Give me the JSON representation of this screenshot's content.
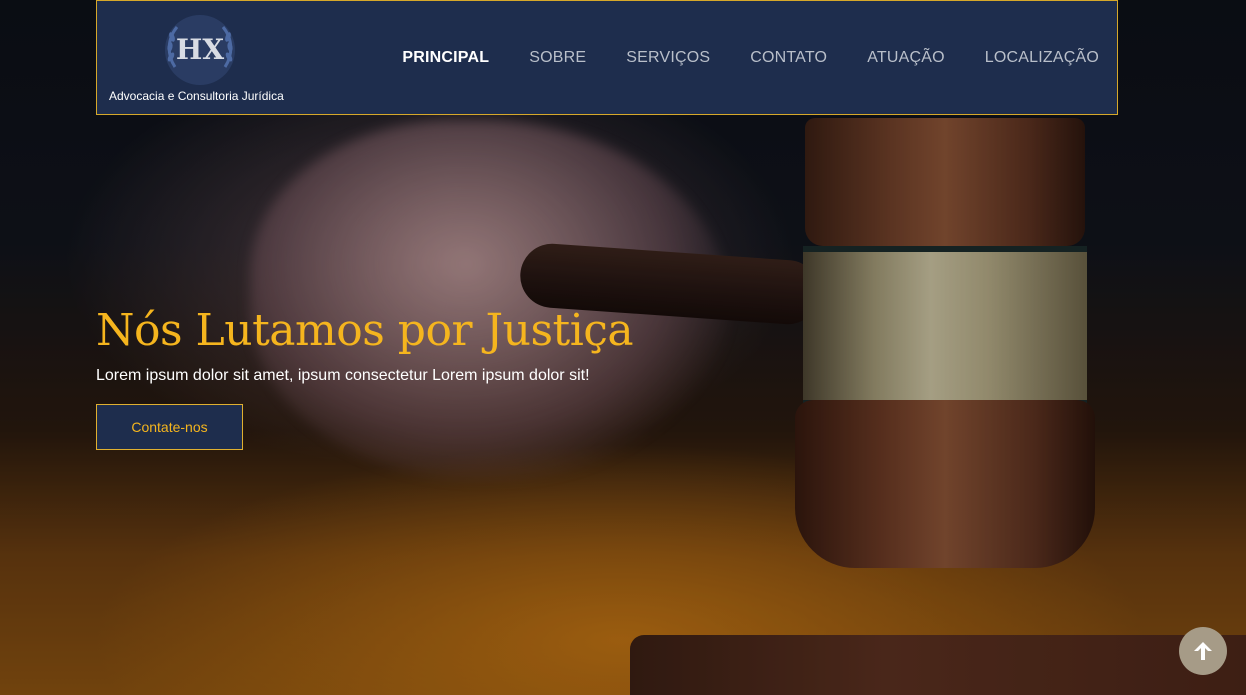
{
  "brand": {
    "logo_letters": "HX",
    "tagline": "Advocacia e Consultoria Jurídica"
  },
  "nav": {
    "items": [
      {
        "label": "PRINCIPAL",
        "active": true
      },
      {
        "label": "SOBRE",
        "active": false
      },
      {
        "label": "SERVIÇOS",
        "active": false
      },
      {
        "label": "CONTATO",
        "active": false
      },
      {
        "label": "ATUAÇÃO",
        "active": false
      },
      {
        "label": "LOCALIZAÇÃO",
        "active": false
      }
    ]
  },
  "hero": {
    "title": "Nós Lutamos por Justiça",
    "subtitle": "Lorem ipsum dolor sit amet, ipsum consectetur Lorem ipsum dolor sit!",
    "cta_label": "Contate-nos"
  },
  "icons": {
    "back_to_top": "arrow-up-icon",
    "logo": "laurel-wreath-icon"
  },
  "colors": {
    "navbar_bg": "#1e2d4d",
    "accent_gold": "#f5b51e",
    "navbar_border": "#d6a82a",
    "back_to_top_bg": "#a69b87"
  }
}
